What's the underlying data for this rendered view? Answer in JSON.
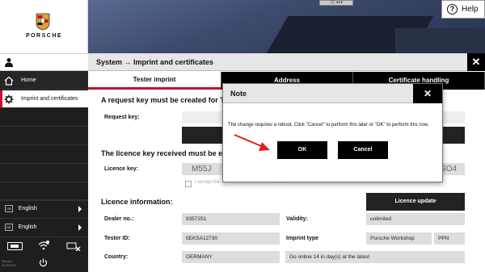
{
  "sidebar": {
    "brand": "PORSCHE",
    "nav": [
      {
        "label": "Home"
      },
      {
        "label": "Imprint and certificates"
      }
    ],
    "languages": [
      {
        "tag": "GB",
        "label": "English"
      },
      {
        "tag": "DE",
        "label": "English"
      }
    ],
    "version": "Release 40.300.000",
    "icons": {
      "user": "user-icon",
      "home": "home-icon",
      "gear": "gear-icon",
      "battery": "battery-icon",
      "wifi": "wifi-icon",
      "cloud": "cloud-disconnected-icon",
      "power": "power-icon"
    }
  },
  "topbar": {
    "remote_toolbar": "▫◫ ◂◂ ▸",
    "help_label": "Help",
    "help_glyph": "?"
  },
  "window": {
    "title": "System → Imprint and certificates",
    "close_glyph": "✕",
    "tabs": [
      {
        "label": "Tester imprint",
        "active": true
      },
      {
        "label": "Address",
        "active": false
      },
      {
        "label": "Certificate handling",
        "active": false
      }
    ]
  },
  "content": {
    "request_heading": "A request key must be created for Tester",
    "request_key_label": "Request key:",
    "create_button_partial": "C",
    "licence_heading": "The licence key received must be entere",
    "licence_key_label": "Licence key:",
    "licence_key_left": "M55J",
    "licence_key_right": "GO4",
    "accept_text": "I accept the",
    "accept_tail": "...",
    "licence_info_heading": "Licence information:",
    "licence_update_button": "Licence update",
    "dealer_label": "Dealer no.:",
    "dealer_value": "9357251",
    "validity_label": "Validity:",
    "validity_value": "unlimited",
    "tester_label": "Tester ID:",
    "tester_value": "5EKSA12730",
    "imprint_type_label": "Imprint type",
    "imprint_type_value": "Porsche Workshop",
    "imprint_type_code": "PPN",
    "country_label": "Country:",
    "country_value": "GERMANY",
    "online_note": "Go online 14 in day(s) at the latest"
  },
  "dialog": {
    "title": "Note",
    "close_glyph": "✕",
    "message": "The change requires a reboot. Click \"Cancel\" to perform this later or \"OK\" to perform this now.",
    "ok_label": "OK",
    "cancel_label": "Cancel",
    "arrow_color": "#e0201c"
  }
}
